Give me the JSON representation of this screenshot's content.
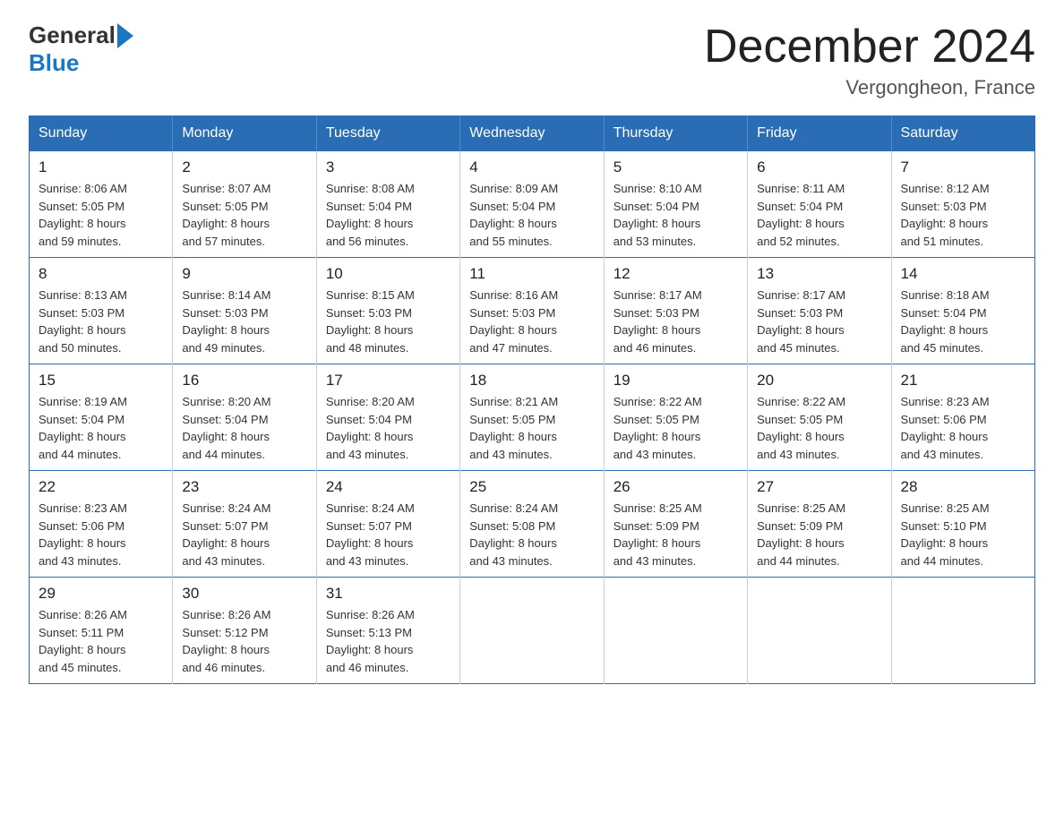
{
  "header": {
    "logo_general": "General",
    "logo_blue": "Blue",
    "title": "December 2024",
    "subtitle": "Vergongheon, France"
  },
  "weekdays": [
    "Sunday",
    "Monday",
    "Tuesday",
    "Wednesday",
    "Thursday",
    "Friday",
    "Saturday"
  ],
  "weeks": [
    [
      {
        "day": "1",
        "detail": "Sunrise: 8:06 AM\nSunset: 5:05 PM\nDaylight: 8 hours\nand 59 minutes."
      },
      {
        "day": "2",
        "detail": "Sunrise: 8:07 AM\nSunset: 5:05 PM\nDaylight: 8 hours\nand 57 minutes."
      },
      {
        "day": "3",
        "detail": "Sunrise: 8:08 AM\nSunset: 5:04 PM\nDaylight: 8 hours\nand 56 minutes."
      },
      {
        "day": "4",
        "detail": "Sunrise: 8:09 AM\nSunset: 5:04 PM\nDaylight: 8 hours\nand 55 minutes."
      },
      {
        "day": "5",
        "detail": "Sunrise: 8:10 AM\nSunset: 5:04 PM\nDaylight: 8 hours\nand 53 minutes."
      },
      {
        "day": "6",
        "detail": "Sunrise: 8:11 AM\nSunset: 5:04 PM\nDaylight: 8 hours\nand 52 minutes."
      },
      {
        "day": "7",
        "detail": "Sunrise: 8:12 AM\nSunset: 5:03 PM\nDaylight: 8 hours\nand 51 minutes."
      }
    ],
    [
      {
        "day": "8",
        "detail": "Sunrise: 8:13 AM\nSunset: 5:03 PM\nDaylight: 8 hours\nand 50 minutes."
      },
      {
        "day": "9",
        "detail": "Sunrise: 8:14 AM\nSunset: 5:03 PM\nDaylight: 8 hours\nand 49 minutes."
      },
      {
        "day": "10",
        "detail": "Sunrise: 8:15 AM\nSunset: 5:03 PM\nDaylight: 8 hours\nand 48 minutes."
      },
      {
        "day": "11",
        "detail": "Sunrise: 8:16 AM\nSunset: 5:03 PM\nDaylight: 8 hours\nand 47 minutes."
      },
      {
        "day": "12",
        "detail": "Sunrise: 8:17 AM\nSunset: 5:03 PM\nDaylight: 8 hours\nand 46 minutes."
      },
      {
        "day": "13",
        "detail": "Sunrise: 8:17 AM\nSunset: 5:03 PM\nDaylight: 8 hours\nand 45 minutes."
      },
      {
        "day": "14",
        "detail": "Sunrise: 8:18 AM\nSunset: 5:04 PM\nDaylight: 8 hours\nand 45 minutes."
      }
    ],
    [
      {
        "day": "15",
        "detail": "Sunrise: 8:19 AM\nSunset: 5:04 PM\nDaylight: 8 hours\nand 44 minutes."
      },
      {
        "day": "16",
        "detail": "Sunrise: 8:20 AM\nSunset: 5:04 PM\nDaylight: 8 hours\nand 44 minutes."
      },
      {
        "day": "17",
        "detail": "Sunrise: 8:20 AM\nSunset: 5:04 PM\nDaylight: 8 hours\nand 43 minutes."
      },
      {
        "day": "18",
        "detail": "Sunrise: 8:21 AM\nSunset: 5:05 PM\nDaylight: 8 hours\nand 43 minutes."
      },
      {
        "day": "19",
        "detail": "Sunrise: 8:22 AM\nSunset: 5:05 PM\nDaylight: 8 hours\nand 43 minutes."
      },
      {
        "day": "20",
        "detail": "Sunrise: 8:22 AM\nSunset: 5:05 PM\nDaylight: 8 hours\nand 43 minutes."
      },
      {
        "day": "21",
        "detail": "Sunrise: 8:23 AM\nSunset: 5:06 PM\nDaylight: 8 hours\nand 43 minutes."
      }
    ],
    [
      {
        "day": "22",
        "detail": "Sunrise: 8:23 AM\nSunset: 5:06 PM\nDaylight: 8 hours\nand 43 minutes."
      },
      {
        "day": "23",
        "detail": "Sunrise: 8:24 AM\nSunset: 5:07 PM\nDaylight: 8 hours\nand 43 minutes."
      },
      {
        "day": "24",
        "detail": "Sunrise: 8:24 AM\nSunset: 5:07 PM\nDaylight: 8 hours\nand 43 minutes."
      },
      {
        "day": "25",
        "detail": "Sunrise: 8:24 AM\nSunset: 5:08 PM\nDaylight: 8 hours\nand 43 minutes."
      },
      {
        "day": "26",
        "detail": "Sunrise: 8:25 AM\nSunset: 5:09 PM\nDaylight: 8 hours\nand 43 minutes."
      },
      {
        "day": "27",
        "detail": "Sunrise: 8:25 AM\nSunset: 5:09 PM\nDaylight: 8 hours\nand 44 minutes."
      },
      {
        "day": "28",
        "detail": "Sunrise: 8:25 AM\nSunset: 5:10 PM\nDaylight: 8 hours\nand 44 minutes."
      }
    ],
    [
      {
        "day": "29",
        "detail": "Sunrise: 8:26 AM\nSunset: 5:11 PM\nDaylight: 8 hours\nand 45 minutes."
      },
      {
        "day": "30",
        "detail": "Sunrise: 8:26 AM\nSunset: 5:12 PM\nDaylight: 8 hours\nand 46 minutes."
      },
      {
        "day": "31",
        "detail": "Sunrise: 8:26 AM\nSunset: 5:13 PM\nDaylight: 8 hours\nand 46 minutes."
      },
      {
        "day": "",
        "detail": ""
      },
      {
        "day": "",
        "detail": ""
      },
      {
        "day": "",
        "detail": ""
      },
      {
        "day": "",
        "detail": ""
      }
    ]
  ]
}
